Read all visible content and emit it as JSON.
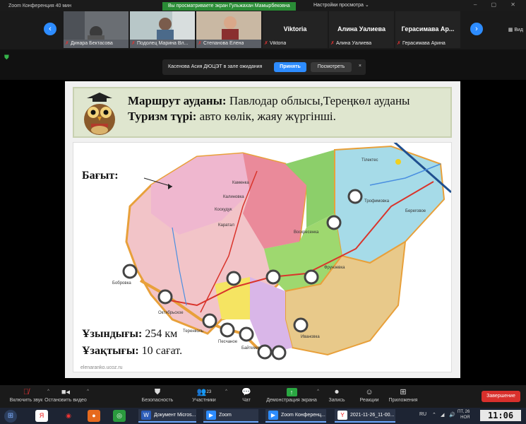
{
  "window": {
    "title": "Zoom Конференция  40 мин",
    "share_banner": "Вы просматриваете экран Гульжахан Мамырбековна",
    "view_options": "Настройки просмотра ⌄",
    "view_label": "Вид"
  },
  "gallery": {
    "participants": [
      {
        "name": "Динара Бектасова",
        "video": true
      },
      {
        "name": "Подолец Марина Вл...",
        "video": true
      },
      {
        "name": "Степанова Елена",
        "video": true
      },
      {
        "name": "Viktoria",
        "display": "Viktoria",
        "video": false
      },
      {
        "name": "Алина Уалиева",
        "display": "Алина Уалиева",
        "video": false
      },
      {
        "name": "Герасимава Арина",
        "display": "Герасимава  Ар...",
        "video": false
      }
    ]
  },
  "waiting_room": {
    "message": "Касенова Асия ДЮЦЭТ в зале ожидания",
    "admit_label": "Принять",
    "see_label": "Посмотреть",
    "close_label": "×"
  },
  "slide": {
    "line1_bold": "Маршрут ауданы:",
    "line1_text": " Павлодар облысы,Тереңкөл ауданы",
    "line2_bold": "Туризм түрі:",
    "line2_text": " авто көлік, жаяу жүргінші.",
    "direction_label": "Бағыт:",
    "length_label": "Ұзындығы:",
    "length_value": " 254 км",
    "duration_label": "Ұзақтығы:",
    "duration_value": " 10 сағат.",
    "watermark": "elenaranko.ucoz.ru",
    "map_places": [
      "Тілектес",
      "Трофимовка",
      "Береговое",
      "Каменка",
      "Калиновка",
      "Коскудук",
      "Каратал",
      "Воскресенка",
      "Фрунзевка",
      "Бобровка",
      "Октябрьское",
      "Теренколь",
      "Песчаное",
      "Байтемир",
      "Ивановка"
    ]
  },
  "toolbar": {
    "mute": "Включить звук",
    "video": "Остановить видео",
    "security": "Безопасность",
    "participants": "Участники",
    "participants_count": "23",
    "chat": "Чат",
    "share": "Демонстрация экрана",
    "record": "Запись",
    "reactions": "Реакции",
    "apps": "Приложения",
    "end": "Завершение"
  },
  "taskbar": {
    "tasks": [
      "Документ Micros...",
      "Zoom",
      "Zoom Конференц...",
      "2021-11-26_11-00..."
    ],
    "lang": "RU",
    "day": "ПТ, 26",
    "month": "НОЯ",
    "time": "11:06"
  },
  "colors": {
    "accent_blue": "#2d8cff",
    "share_green": "#2aa842",
    "end_red": "#d9302c",
    "slide_header_bg": "#dfe6cf"
  }
}
